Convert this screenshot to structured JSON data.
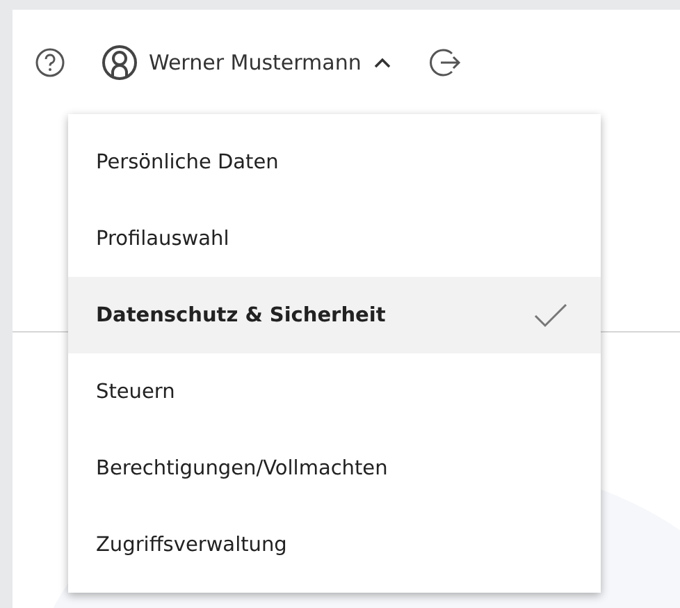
{
  "header": {
    "user_name": "Werner Mustermann",
    "menu_expanded": true
  },
  "menu": [
    {
      "label": "Persönliche Daten",
      "selected": false
    },
    {
      "label": "Profilauswahl",
      "selected": false
    },
    {
      "label": "Datenschutz & Sicherheit",
      "selected": true
    },
    {
      "label": "Steuern",
      "selected": false
    },
    {
      "label": "Berechtigungen/Vollmachten",
      "selected": false
    },
    {
      "label": "Zugriffsverwaltung",
      "selected": false
    }
  ]
}
